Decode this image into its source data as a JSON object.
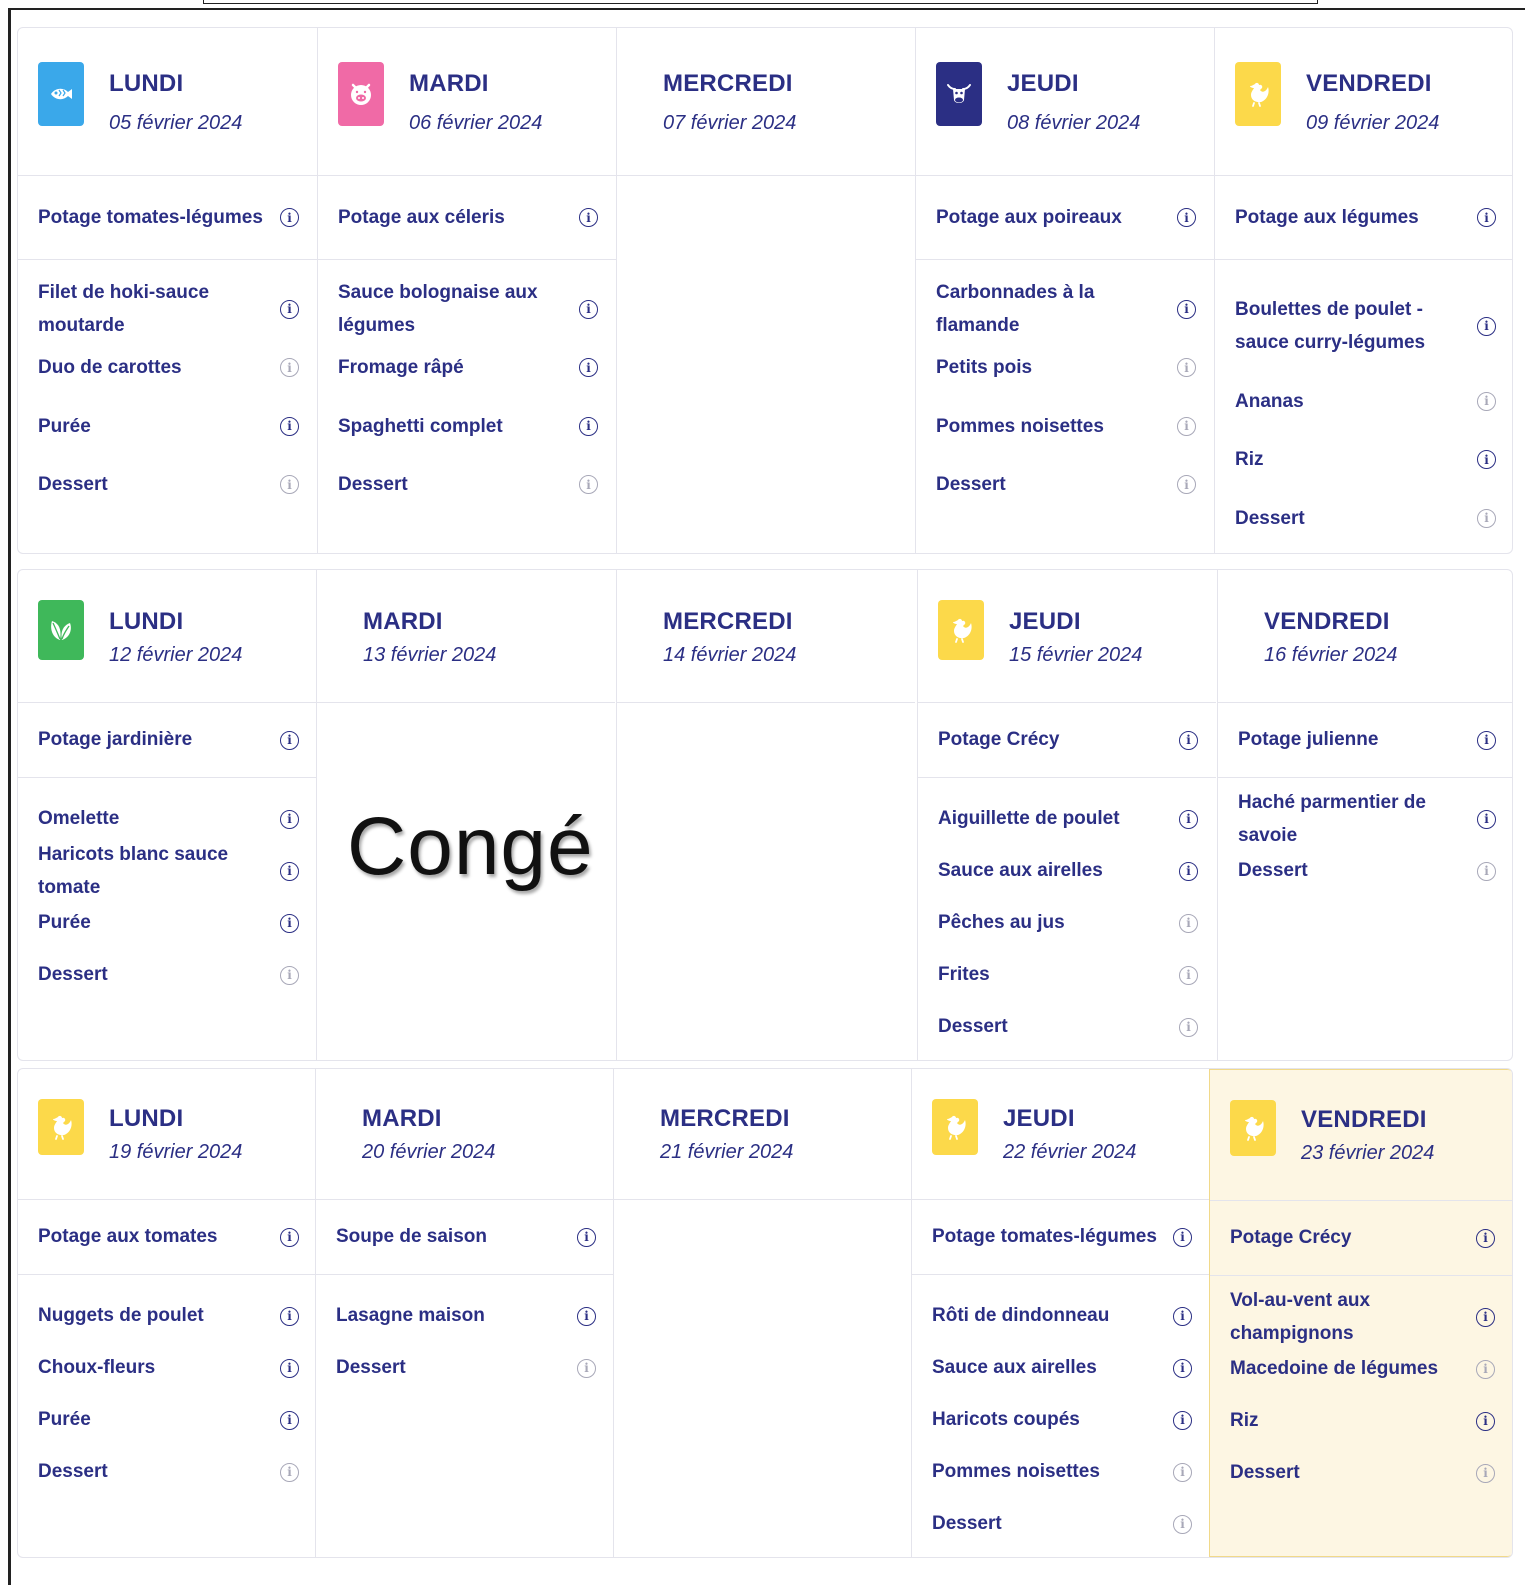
{
  "holiday_label": "Congé",
  "colors": {
    "text": "#2b2f84",
    "fish": "#3aa8ea",
    "pork": "#f06aa6",
    "beef": "#2b2f84",
    "poultry": "#fcd94a",
    "veggie": "#3fb85a",
    "highlight": "#fdf6e3"
  },
  "weeks": [
    {
      "days": [
        {
          "day": "LUNDI",
          "date": "05 février 2024",
          "icon": "fish-icon",
          "starter": "Potage tomates-légumes",
          "mains": [
            {
              "name": "Filet de hoki-sauce moutarde",
              "info": "dark"
            },
            {
              "name": "Duo de carottes",
              "info": "dim"
            },
            {
              "name": "Purée",
              "info": "dark"
            },
            {
              "name": "Dessert",
              "info": "dim"
            }
          ]
        },
        {
          "day": "MARDI",
          "date": "06 février 2024",
          "icon": "pig-icon",
          "starter": "Potage aux céleris",
          "mains": [
            {
              "name": "Sauce bolognaise aux légumes",
              "info": "dark"
            },
            {
              "name": "Fromage râpé",
              "info": "dark"
            },
            {
              "name": "Spaghetti complet",
              "info": "dark"
            },
            {
              "name": "Dessert",
              "info": "dim"
            }
          ]
        },
        {
          "day": "MERCREDI",
          "date": "07 février 2024"
        },
        {
          "day": "JEUDI",
          "date": "08 février 2024",
          "icon": "cow-icon",
          "starter": "Potage aux poireaux",
          "mains": [
            {
              "name": "Carbonnades à la flamande",
              "info": "dark"
            },
            {
              "name": "Petits pois",
              "info": "dim"
            },
            {
              "name": "Pommes noisettes",
              "info": "dim"
            },
            {
              "name": "Dessert",
              "info": "dim"
            }
          ]
        },
        {
          "day": "VENDREDI",
          "date": "09 février 2024",
          "icon": "rooster-icon",
          "starter": "Potage aux légumes",
          "mains": [
            {
              "name": "Boulettes de poulet - sauce curry-légumes",
              "info": "dark",
              "tall": true
            },
            {
              "name": "Ananas",
              "info": "dim"
            },
            {
              "name": "Riz",
              "info": "dark"
            },
            {
              "name": "Dessert",
              "info": "dim"
            }
          ]
        }
      ]
    },
    {
      "days": [
        {
          "day": "LUNDI",
          "date": "12 février 2024",
          "icon": "leaf-icon",
          "starter": "Potage jardinière",
          "mains": [
            {
              "name": "Omelette",
              "info": "dark"
            },
            {
              "name": "Haricots blanc sauce tomate",
              "info": "dark"
            },
            {
              "name": "Purée",
              "info": "dark"
            },
            {
              "name": "Dessert",
              "info": "dim"
            }
          ]
        },
        {
          "day": "MARDI",
          "date": "13 février 2024"
        },
        {
          "day": "MERCREDI",
          "date": "14 février 2024"
        },
        {
          "day": "JEUDI",
          "date": "15 février 2024",
          "icon": "rooster-icon",
          "starter": "Potage Crécy",
          "mains": [
            {
              "name": "Aiguillette de poulet",
              "info": "dark"
            },
            {
              "name": "Sauce aux airelles",
              "info": "dark"
            },
            {
              "name": "Pêches au jus",
              "info": "dim"
            },
            {
              "name": "Frites",
              "info": "dim"
            },
            {
              "name": "Dessert",
              "info": "dim"
            }
          ]
        },
        {
          "day": "VENDREDI",
          "date": "16 février 2024",
          "starter": "Potage julienne",
          "mains": [
            {
              "name": "Haché parmentier de savoie",
              "info": "dark"
            },
            {
              "name": "Dessert",
              "info": "dim"
            }
          ]
        }
      ]
    },
    {
      "days": [
        {
          "day": "LUNDI",
          "date": "19 février 2024",
          "icon": "rooster-icon",
          "starter": "Potage aux tomates",
          "mains": [
            {
              "name": "Nuggets de poulet",
              "info": "dark"
            },
            {
              "name": "Choux-fleurs",
              "info": "dark"
            },
            {
              "name": "Purée",
              "info": "dark"
            },
            {
              "name": "Dessert",
              "info": "dim"
            }
          ]
        },
        {
          "day": "MARDI",
          "date": "20 février 2024",
          "starter": "Soupe de saison",
          "mains": [
            {
              "name": "Lasagne maison",
              "info": "dark"
            },
            {
              "name": "Dessert",
              "info": "dim"
            }
          ]
        },
        {
          "day": "MERCREDI",
          "date": "21 février 2024"
        },
        {
          "day": "JEUDI",
          "date": "22 février 2024",
          "icon": "rooster-icon",
          "starter": "Potage tomates-légumes",
          "mains": [
            {
              "name": "Rôti de dindonneau",
              "info": "dark"
            },
            {
              "name": "Sauce aux airelles",
              "info": "dark"
            },
            {
              "name": "Haricots coupés",
              "info": "dark"
            },
            {
              "name": "Pommes noisettes",
              "info": "dim"
            },
            {
              "name": "Dessert",
              "info": "dim"
            }
          ]
        },
        {
          "day": "VENDREDI",
          "date": "23 février 2024",
          "icon": "rooster-icon",
          "highlight": true,
          "starter": "Potage Crécy",
          "mains": [
            {
              "name": "Vol-au-vent aux champignons",
              "info": "dark"
            },
            {
              "name": "Macedoine de légumes",
              "info": "dim"
            },
            {
              "name": "Riz",
              "info": "dark"
            },
            {
              "name": "Dessert",
              "info": "dim"
            }
          ]
        }
      ]
    }
  ]
}
